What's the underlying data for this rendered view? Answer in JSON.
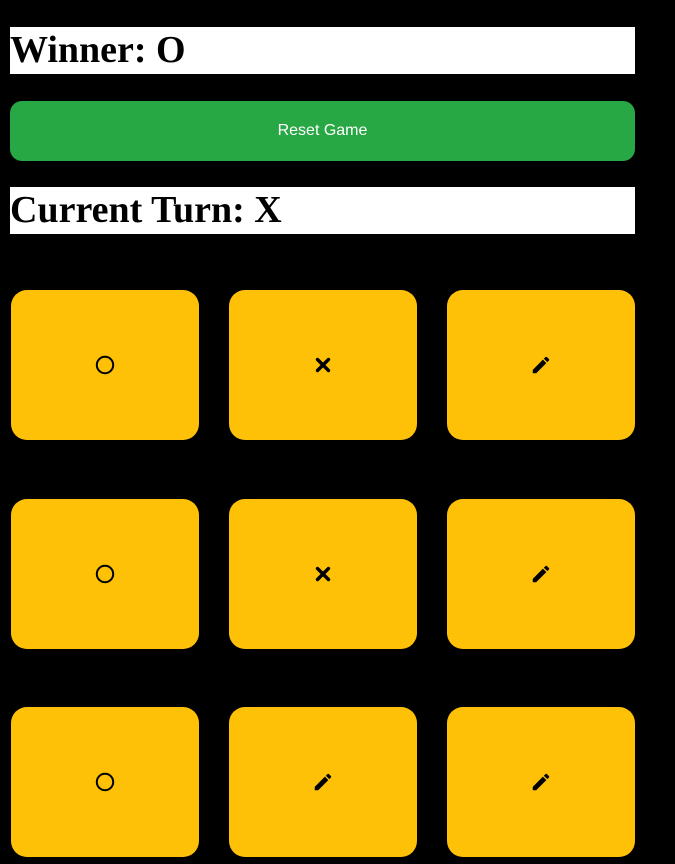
{
  "status": {
    "winner_text": "Winner: O",
    "turn_text": "Current Turn: X"
  },
  "controls": {
    "reset_label": "Reset Game"
  },
  "colors": {
    "background": "#000000",
    "banner": "#ffffff",
    "reset_button": "#28a745",
    "cell": "#ffc107",
    "mark": "#000000"
  },
  "board": {
    "rows": [
      [
        "circle-icon",
        "x-icon",
        "pencil-icon"
      ],
      [
        "circle-icon",
        "x-icon",
        "pencil-icon"
      ],
      [
        "circle-icon",
        "pencil-icon",
        "pencil-icon"
      ]
    ]
  }
}
